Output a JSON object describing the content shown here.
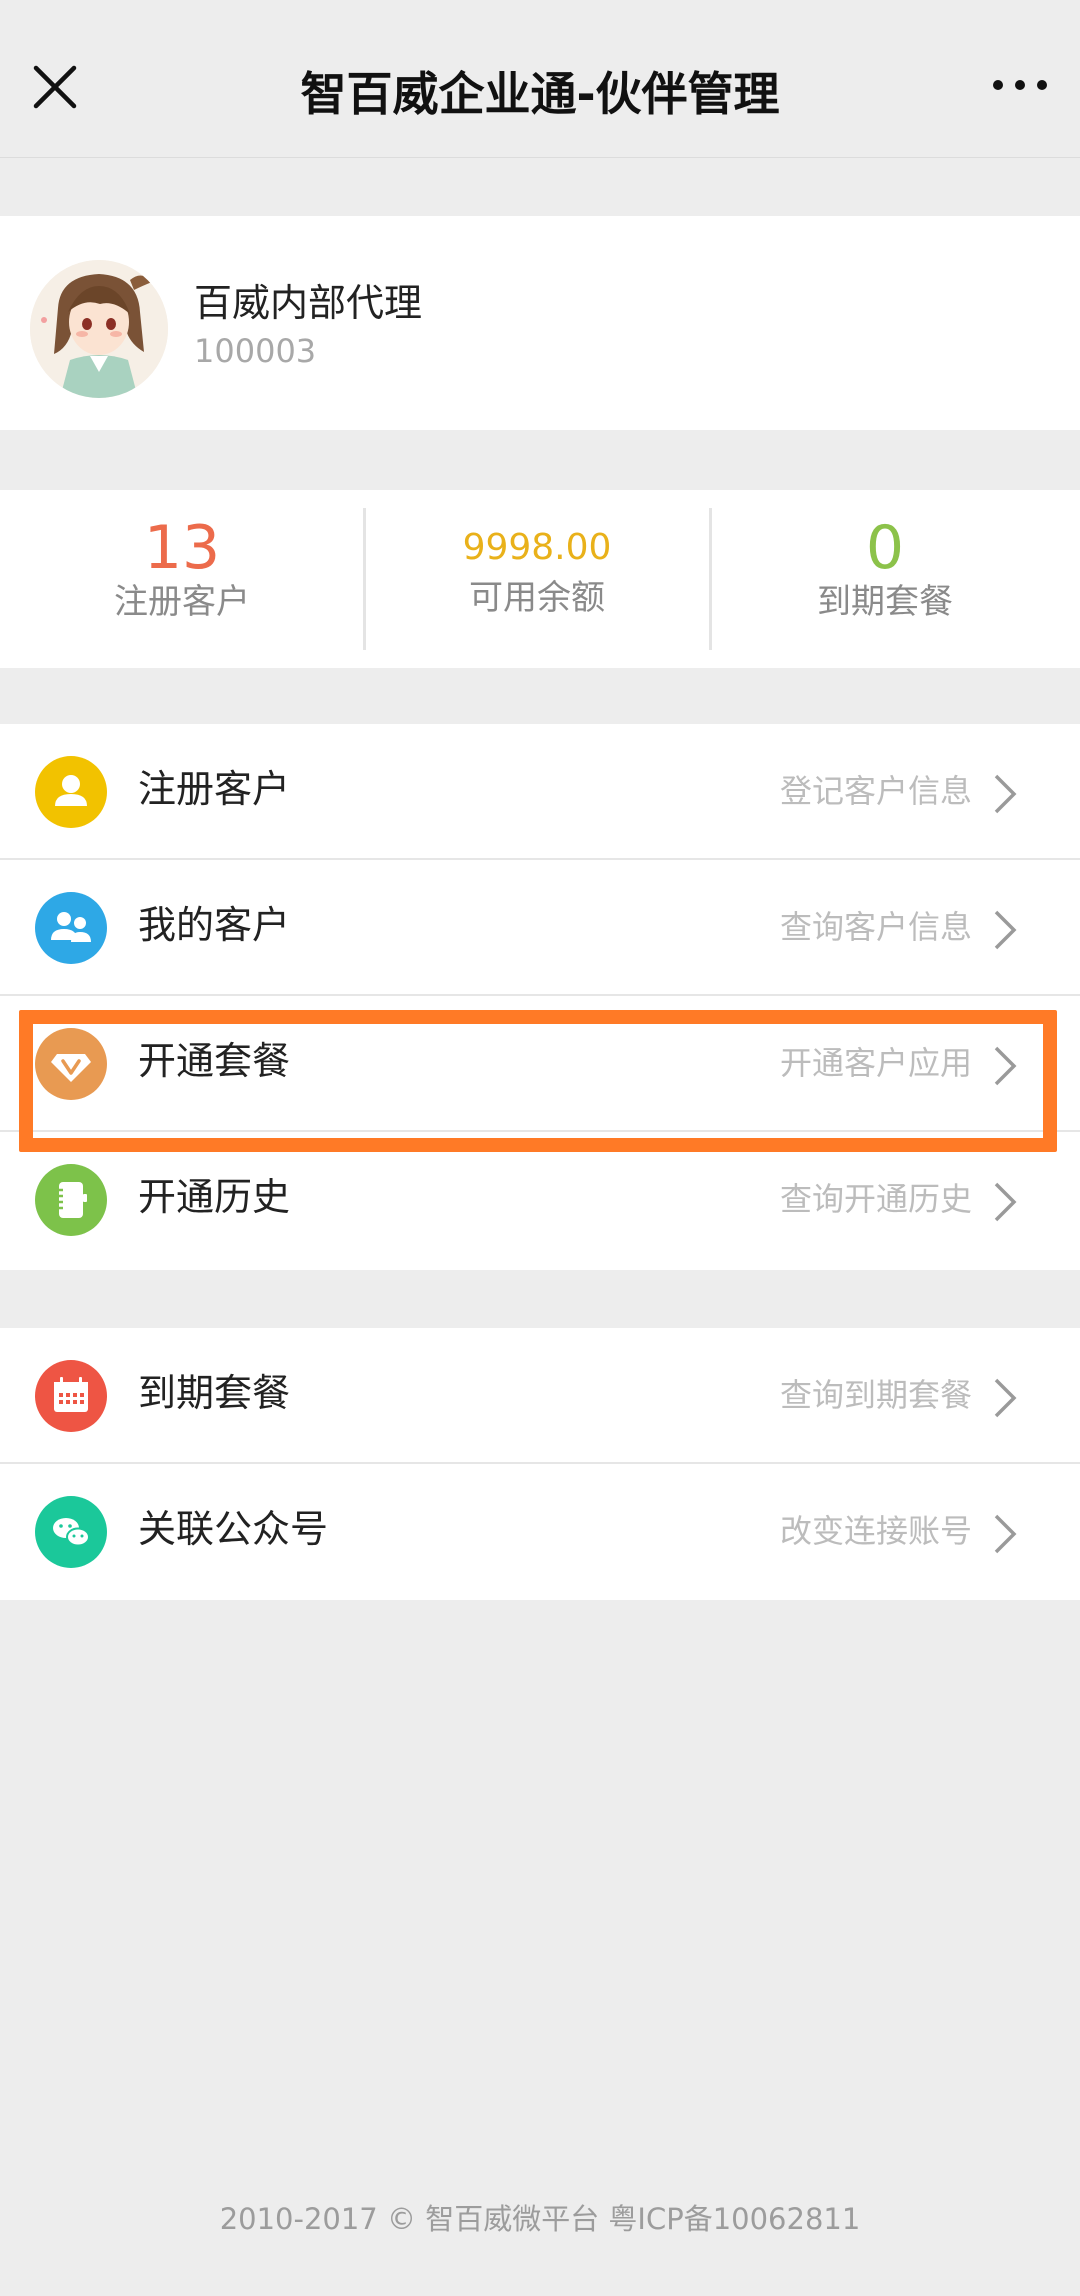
{
  "nav": {
    "title": "智百威企业通-伙伴管理",
    "close_icon": "close-icon",
    "more_icon": "more-icon"
  },
  "profile": {
    "name": "百威内部代理",
    "id": "100003"
  },
  "stats": [
    {
      "value": "13",
      "label": "注册客户",
      "color": "#ec6b4b"
    },
    {
      "value": "9998.00",
      "label": "可用余额",
      "color": "#e9b11a"
    },
    {
      "value": "0",
      "label": "到期套餐",
      "color": "#8cc24a"
    }
  ],
  "menu_group_1": [
    {
      "title": "注册客户",
      "desc": "登记客户信息",
      "icon": "user-icon",
      "color": "#f2c200"
    },
    {
      "title": "我的客户",
      "desc": "查询客户信息",
      "icon": "users-icon",
      "color": "#2ea8e6"
    },
    {
      "title": "开通套餐",
      "desc": "开通客户应用",
      "icon": "diamond-icon",
      "color": "#e89a52"
    },
    {
      "title": "开通历史",
      "desc": "查询开通历史",
      "icon": "notebook-icon",
      "color": "#7dc24a"
    }
  ],
  "menu_group_2": [
    {
      "title": "到期套餐",
      "desc": "查询到期套餐",
      "icon": "calendar-icon",
      "color": "#ee5544"
    },
    {
      "title": "关联公众号",
      "desc": "改变连接账号",
      "icon": "wechat-icon",
      "color": "#1bc89a"
    }
  ],
  "footer": "2010-2017 © 智百威微平台 粤ICP备10062811",
  "highlight_color": "#ff7a26"
}
